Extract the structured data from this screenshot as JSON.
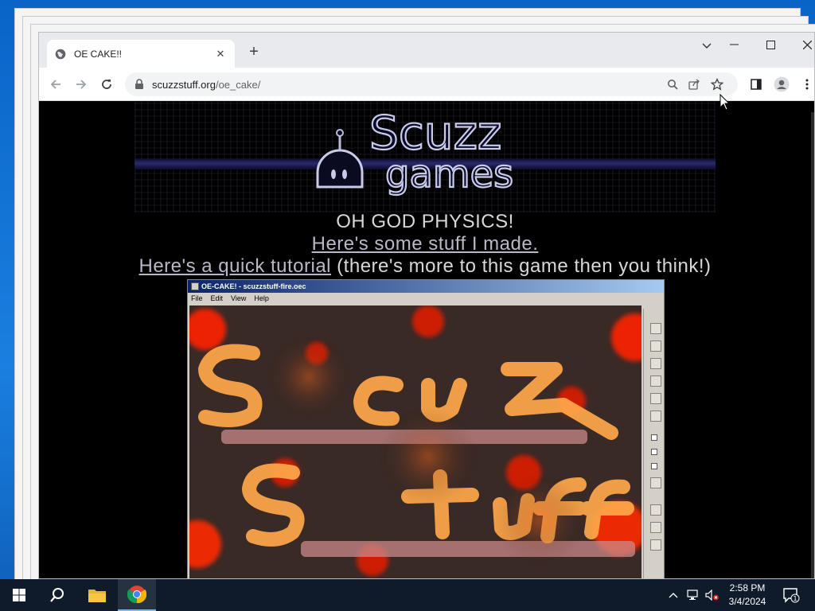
{
  "browser": {
    "tab_title": "OE CAKE!!",
    "url_host": "scuzzstuff.org",
    "url_path": "/oe_cake/"
  },
  "page": {
    "logo_line1": "Scuzz",
    "logo_line2": "games",
    "headline": "OH GOD PHYSICS!",
    "link_stuff": "Here's some stuff I made.",
    "link_tutorial": "Here's a quick tutorial",
    "tutorial_suffix": " (there's more to this game then you think!)"
  },
  "app_window": {
    "title": "OE-CAKE! - scuzzstuff-fire.oec",
    "menu": [
      "File",
      "Edit",
      "View",
      "Help"
    ]
  },
  "taskbar": {
    "time": "2:58 PM",
    "date": "3/4/2024",
    "notification_count": "1"
  },
  "colors": {
    "page_bg": "#000000",
    "link": "#b8b8c8",
    "accent_taskbar": "#76b9ed"
  }
}
